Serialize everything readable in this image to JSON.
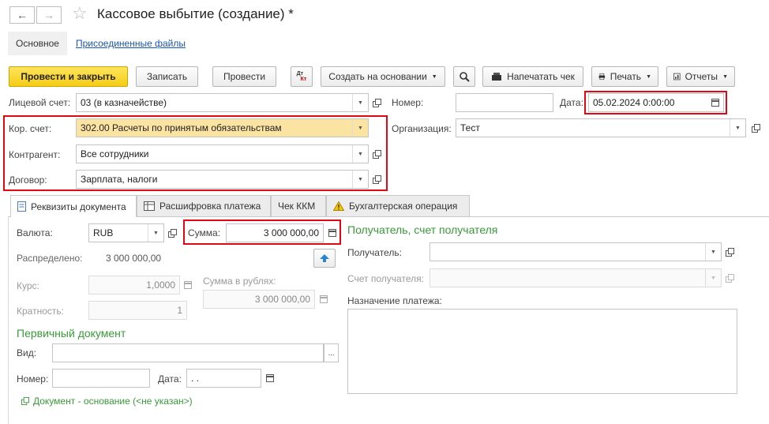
{
  "window": {
    "title": "Кассовое выбытие (создание) *",
    "back_icon": "arrow-left-icon",
    "forward_icon": "arrow-right-icon",
    "favorite_icon": "star-icon"
  },
  "top_tabs": [
    {
      "label": "Основное"
    },
    {
      "label": "Присоединенные файлы"
    }
  ],
  "toolbar": {
    "post_close": "Провести и закрыть",
    "save": "Записать",
    "post": "Провести",
    "dt_kt_top": "Дт",
    "dt_kt_bottom": "Кт",
    "create_based": "Создать на основании",
    "print_check": "Напечатать чек",
    "print": "Печать",
    "reports": "Отчеты"
  },
  "header": {
    "account_label": "Лицевой счет:",
    "account_value": "03 (в казначействе)",
    "number_label": "Номер:",
    "number_value": "",
    "date_label": "Дата:",
    "date_value": "05.02.2024  0:00:00",
    "corr_label": "Кор. счет:",
    "corr_value": "302.00 Расчеты по принятым обязательствам",
    "org_label": "Организация:",
    "org_value": "Тест",
    "contractor_label": "Контрагент:",
    "contractor_value": "Все сотрудники",
    "contract_label": "Договор:",
    "contract_value": "Зарплата, налоги"
  },
  "doc_tabs": [
    {
      "label": "Реквизиты документа",
      "icon": "document-icon"
    },
    {
      "label": "Расшифровка платежа",
      "icon": "table-icon"
    },
    {
      "label": "Чек ККМ",
      "icon": ""
    },
    {
      "label": "Бухгалтерская операция",
      "icon": "warning-icon"
    }
  ],
  "details": {
    "currency_label": "Валюта:",
    "currency_value": "RUB",
    "amount_label": "Сумма:",
    "amount_value": "3 000 000,00",
    "distributed_label": "Распределено:",
    "distributed_value": "3 000 000,00",
    "rate_label": "Курс:",
    "rate_value": "1,0000",
    "rub_amount_label": "Сумма в рублях:",
    "rub_amount_value": "3 000 000,00",
    "multiplicity_label": "Кратность:",
    "multiplicity_value": "1"
  },
  "primary_doc": {
    "title": "Первичный документ",
    "kind_label": "Вид:",
    "kind_value": "",
    "number_label": "Номер:",
    "number_value": "",
    "date_label": "Дата:",
    "date_value": " .  .",
    "base_doc_link": "Документ - основание (<не указан>)"
  },
  "recipient": {
    "title": "Получатель, счет получателя",
    "recipient_label": "Получатель:",
    "recipient_value": "",
    "account_label": "Счет получателя:",
    "account_value": "",
    "purpose_label": "Назначение платежа:",
    "purpose_value": ""
  },
  "colors": {
    "highlight_border": "#e30613",
    "primary_button": "#f5cd14",
    "section_title": "#3a9a3a",
    "link": "#1a56b0"
  }
}
